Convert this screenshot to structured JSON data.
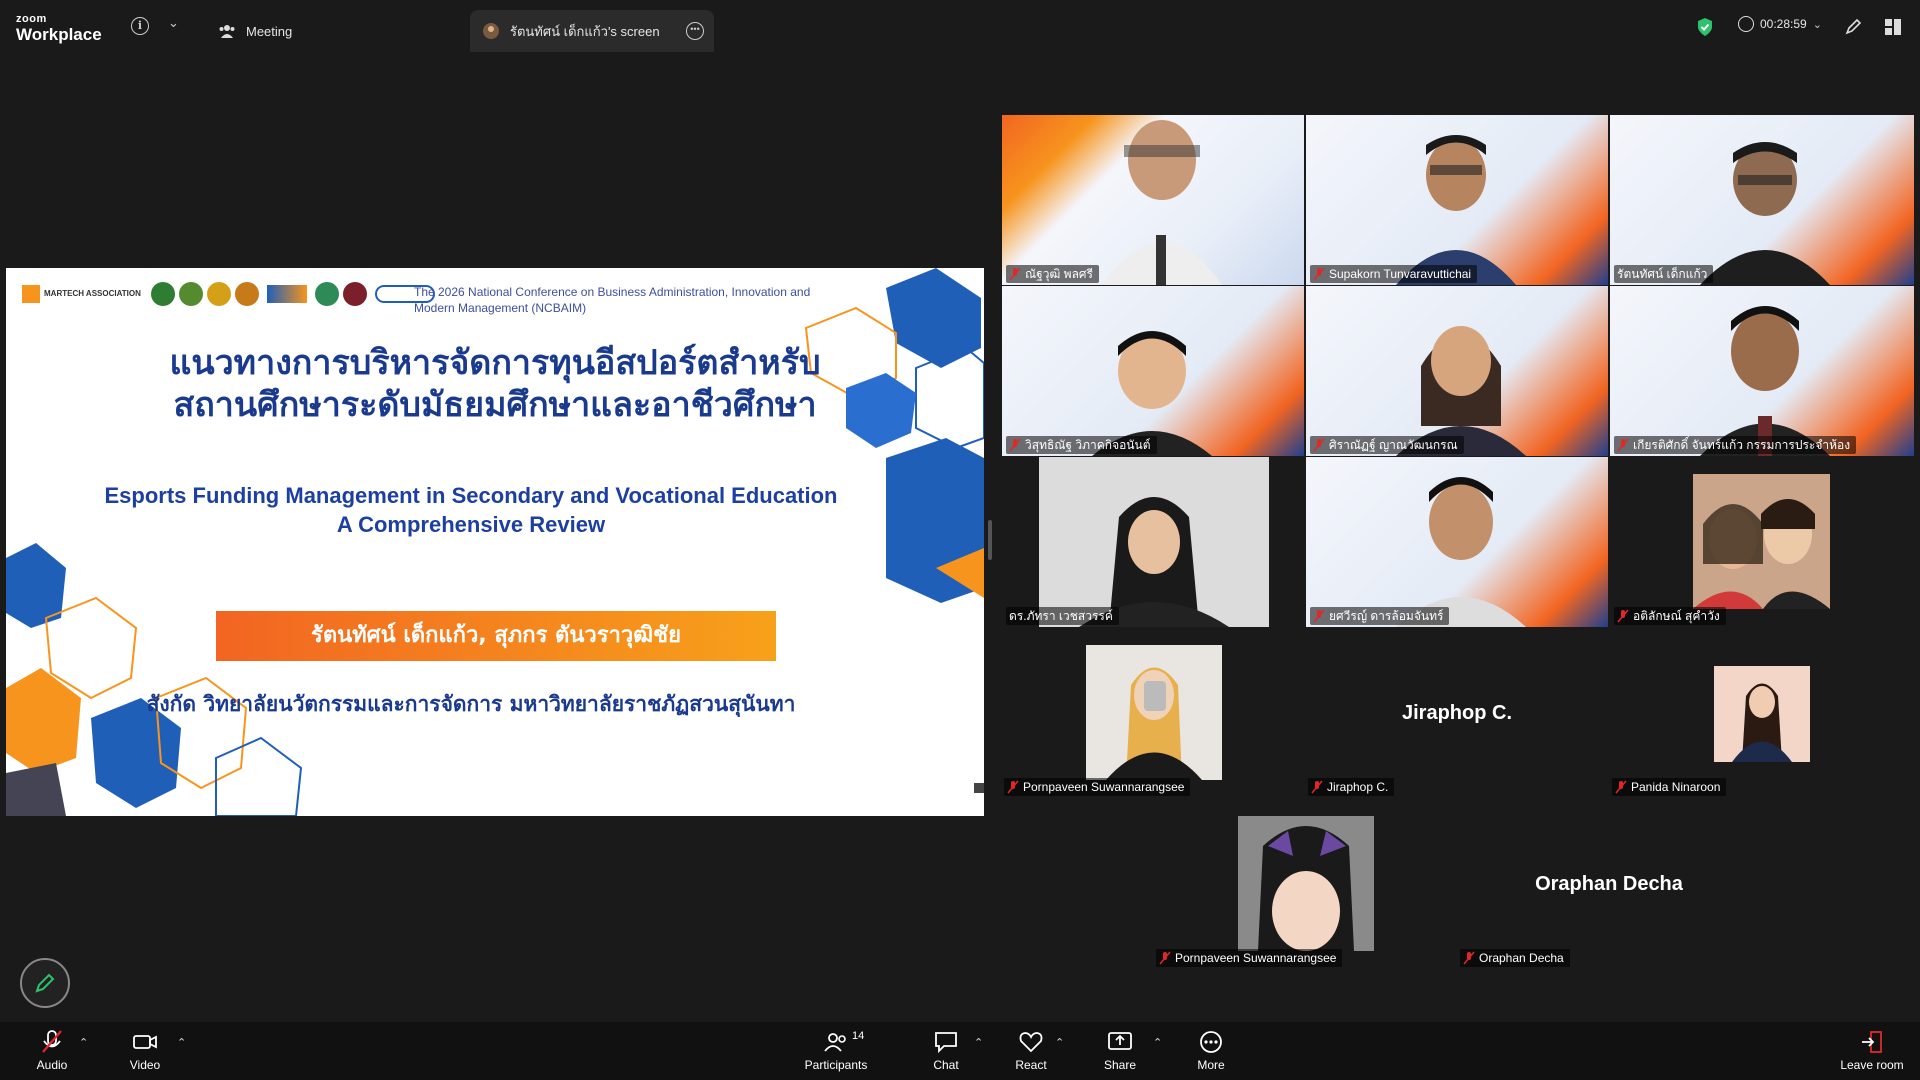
{
  "app": {
    "logo_small": "zoom",
    "logo_big": "Workplace",
    "meeting_tab": "Meeting",
    "screen_tab": "รัตนทัศน์ เด็กแก้ว's screen",
    "timer": "00:28:59",
    "colors": {
      "accent_green": "#2dc26b",
      "mute_red": "#e02828",
      "toolbar_bg": "#111111"
    }
  },
  "slide": {
    "conference": "The 2026 National Conference on Business Administration, Innovation and Modern Management (NCBAIM)",
    "logo_text": "MARTECH ASSOCIATION",
    "thai_title_1": "แนวทางการบริหารจัดการทุนอีสปอร์ตสำหรับ",
    "thai_title_2": "สถานศึกษาระดับมัธยมศึกษาและอาชีวศึกษา",
    "en_title_1": "Esports Funding Management in Secondary and Vocational Education",
    "en_title_2": "A Comprehensive Review",
    "authors": "รัตนทัศน์ เด็กแก้ว, สุภกร ตันวราวุฒิชัย",
    "affiliation": "สังกัด วิทยาลัยนวัตกรรมและการจัดการ มหาวิทยาลัยราชภัฏสวนสุนันทา"
  },
  "participants": {
    "tiles": [
      {
        "name": "ณัฐวุฒิ พลศรี"
      },
      {
        "name": "Supakorn Tunvaravuttichai"
      },
      {
        "name": "รัตนทัศน์ เด็กแก้ว"
      },
      {
        "name": "วิสุทธิณัฐ วิภาคกิจอนันต์"
      },
      {
        "name": "ศิราณัฏฐ์ ญาณวัฒนกรณ"
      },
      {
        "name": "เกียรติศักดิ์ จันทร์แก้ว กรรมการประจำห้อง"
      },
      {
        "name": "ดร.ภัทรา เวชสวรรค์"
      },
      {
        "name": "ยศวีรญ์ ดารล้อมจันทร์"
      },
      {
        "name": "อติลักษณ์ สุคำวัง"
      }
    ],
    "row4": [
      {
        "name": "Pornpaveen Suwannarangsee"
      },
      {
        "name": "Jiraphop C.",
        "big": "Jiraphop C."
      },
      {
        "name": "Panida Ninaroon"
      }
    ],
    "row5": [
      {
        "name": "Pornpaveen Suwannarangsee"
      },
      {
        "name": "Oraphan Decha",
        "big": "Oraphan Decha"
      }
    ]
  },
  "toolbar": {
    "audio": "Audio",
    "video": "Video",
    "participants": "Participants",
    "participants_count": "14",
    "chat": "Chat",
    "react": "React",
    "share": "Share",
    "more": "More",
    "leave": "Leave room"
  }
}
